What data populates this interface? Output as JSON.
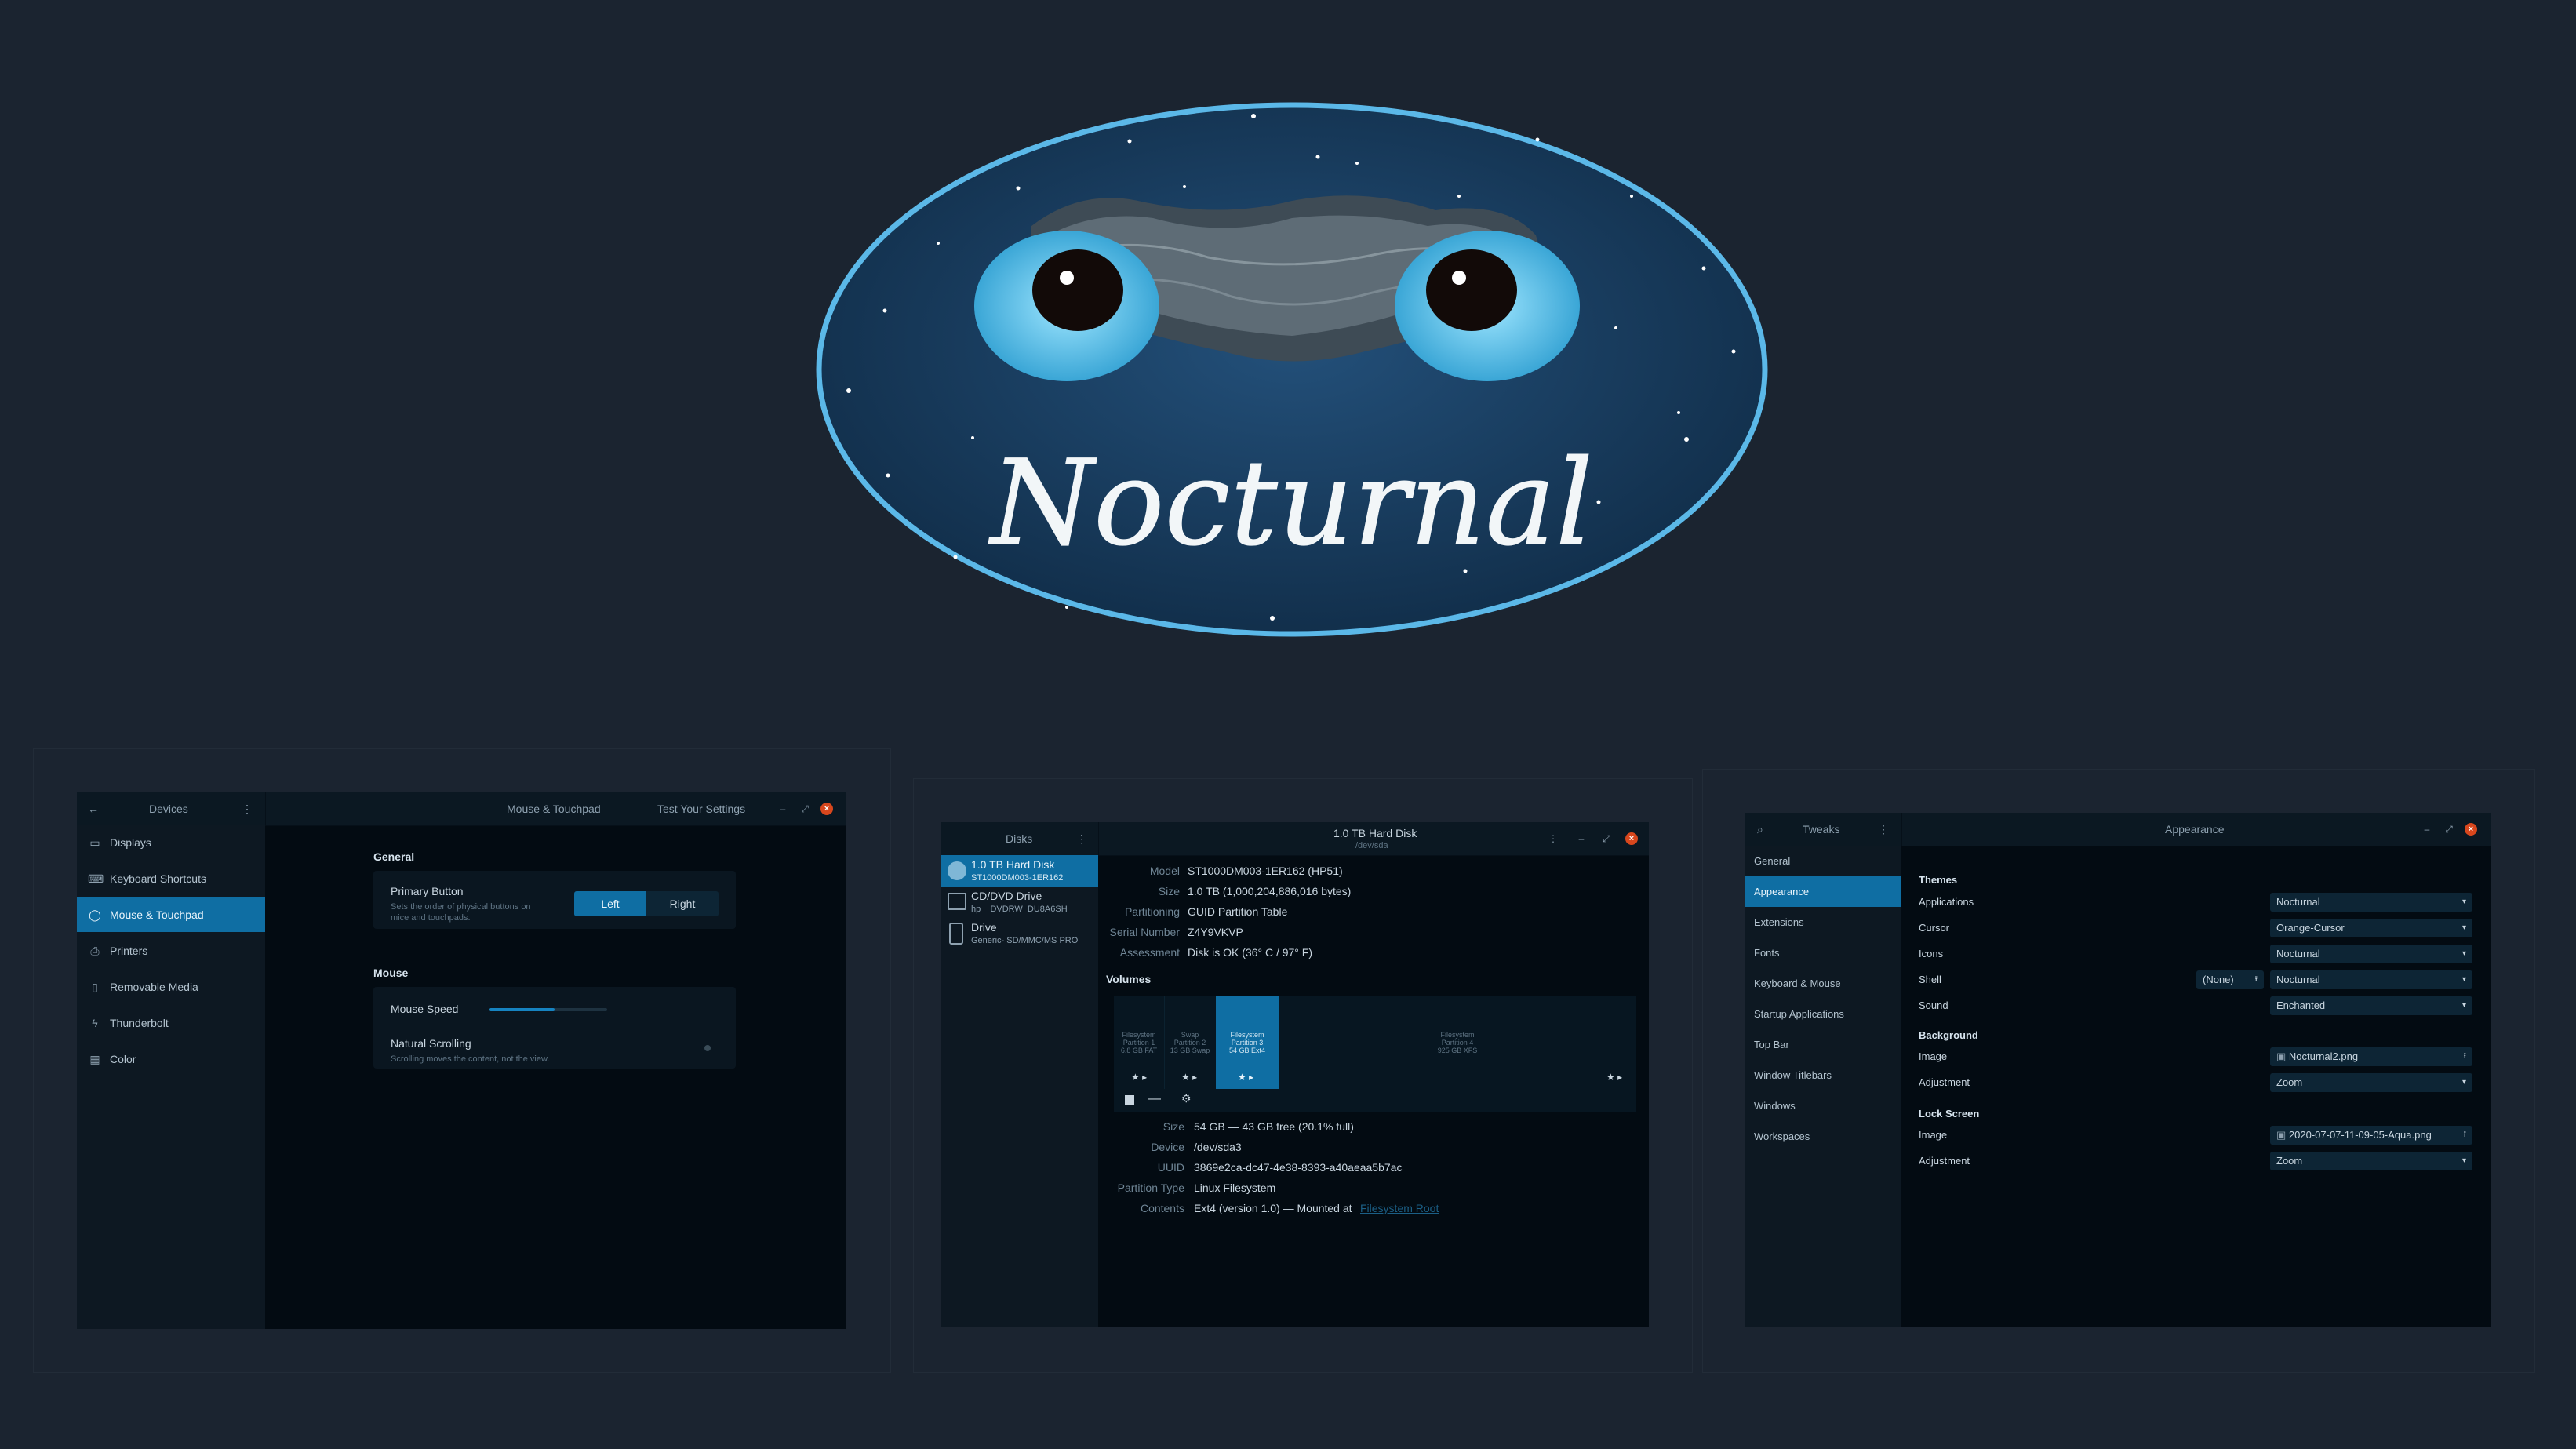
{
  "banner": {
    "title": "Nocturnal"
  },
  "mouse_window": {
    "sidebar_title": "Devices",
    "title": "Mouse & Touchpad",
    "test_button": "Test Your Settings",
    "sidebar": [
      {
        "label": "Displays",
        "icon": "display-icon"
      },
      {
        "label": "Keyboard Shortcuts",
        "icon": "keyboard-icon"
      },
      {
        "label": "Mouse & Touchpad",
        "icon": "mouse-icon",
        "selected": true
      },
      {
        "label": "Printers",
        "icon": "printer-icon"
      },
      {
        "label": "Removable Media",
        "icon": "media-icon"
      },
      {
        "label": "Thunderbolt",
        "icon": "thunderbolt-icon"
      },
      {
        "label": "Color",
        "icon": "color-icon"
      }
    ],
    "general_heading": "General",
    "primary_button_label": "Primary Button",
    "primary_button_desc_1": "Sets the order of physical buttons on",
    "primary_button_desc_2": "mice and touchpads.",
    "left_label": "Left",
    "right_label": "Right",
    "mouse_heading": "Mouse",
    "mouse_speed_label": "Mouse Speed",
    "mouse_speed_value": 0.55,
    "natural_scrolling_label": "Natural Scrolling",
    "natural_scrolling_desc": "Scrolling moves the content, not the view."
  },
  "disks_window": {
    "sidebar_title": "Disks",
    "title": "1.0 TB Hard Disk",
    "subtitle": "/dev/sda",
    "drives": [
      {
        "name": "1.0 TB Hard Disk",
        "detail": "ST1000DM003-1ER162",
        "selected": true
      },
      {
        "name": "CD/DVD Drive",
        "detail": "hp    DVDRW  DU8A6SH"
      },
      {
        "name": "Drive",
        "detail": "Generic- SD/MMC/MS PRO"
      }
    ],
    "info": [
      {
        "key": "Model",
        "value": "ST1000DM003-1ER162 (HP51)"
      },
      {
        "key": "Size",
        "value": "1.0 TB (1,000,204,886,016 bytes)"
      },
      {
        "key": "Partitioning",
        "value": "GUID Partition Table"
      },
      {
        "key": "Serial Number",
        "value": "Z4Y9VKVP"
      },
      {
        "key": "Assessment",
        "value": "Disk is OK (36° C / 97° F)"
      }
    ],
    "volumes_heading": "Volumes",
    "partitions": [
      {
        "l1": "Filesystem",
        "l2": "Partition 1",
        "l3": "6.8 GB FAT"
      },
      {
        "l1": "Swap",
        "l2": "Partition 2",
        "l3": "13 GB Swap"
      },
      {
        "l1": "Filesystem",
        "l2": "Partition 3",
        "l3": "54 GB Ext4"
      },
      {
        "l1": "Filesystem",
        "l2": "Partition 4",
        "l3": "925 GB XFS"
      }
    ],
    "details": [
      {
        "key": "Size",
        "value": "54 GB — 43 GB free (20.1% full)"
      },
      {
        "key": "Device",
        "value": "/dev/sda3"
      },
      {
        "key": "UUID",
        "value": "3869e2ca-dc47-4e38-8393-a40aeaa5b7ac"
      },
      {
        "key": "Partition Type",
        "value": "Linux Filesystem"
      },
      {
        "key": "Contents",
        "value": "Ext4 (version 1.0) — Mounted at",
        "link": "Filesystem Root"
      }
    ]
  },
  "tweaks_window": {
    "sidebar_title": "Tweaks",
    "title": "Appearance",
    "sidebar": [
      "General",
      "Appearance",
      "Extensions",
      "Fonts",
      "Keyboard & Mouse",
      "Startup Applications",
      "Top Bar",
      "Window Titlebars",
      "Windows",
      "Workspaces"
    ],
    "selected_index": 1,
    "themes_heading": "Themes",
    "themes": [
      {
        "label": "Applications",
        "value": "Nocturnal"
      },
      {
        "label": "Cursor",
        "value": "Orange-Cursor"
      },
      {
        "label": "Icons",
        "value": "Nocturnal"
      },
      {
        "label": "Shell",
        "value": "Nocturnal",
        "extra": "(None)"
      },
      {
        "label": "Sound",
        "value": "Enchanted"
      }
    ],
    "background_heading": "Background",
    "background": [
      {
        "label": "Image",
        "value": "Nocturnal2.png"
      },
      {
        "label": "Adjustment",
        "value": "Zoom"
      }
    ],
    "lock_heading": "Lock Screen",
    "lock": [
      {
        "label": "Image",
        "value": "2020-07-07-11-09-05-Aqua.png"
      },
      {
        "label": "Adjustment",
        "value": "Zoom"
      }
    ]
  }
}
